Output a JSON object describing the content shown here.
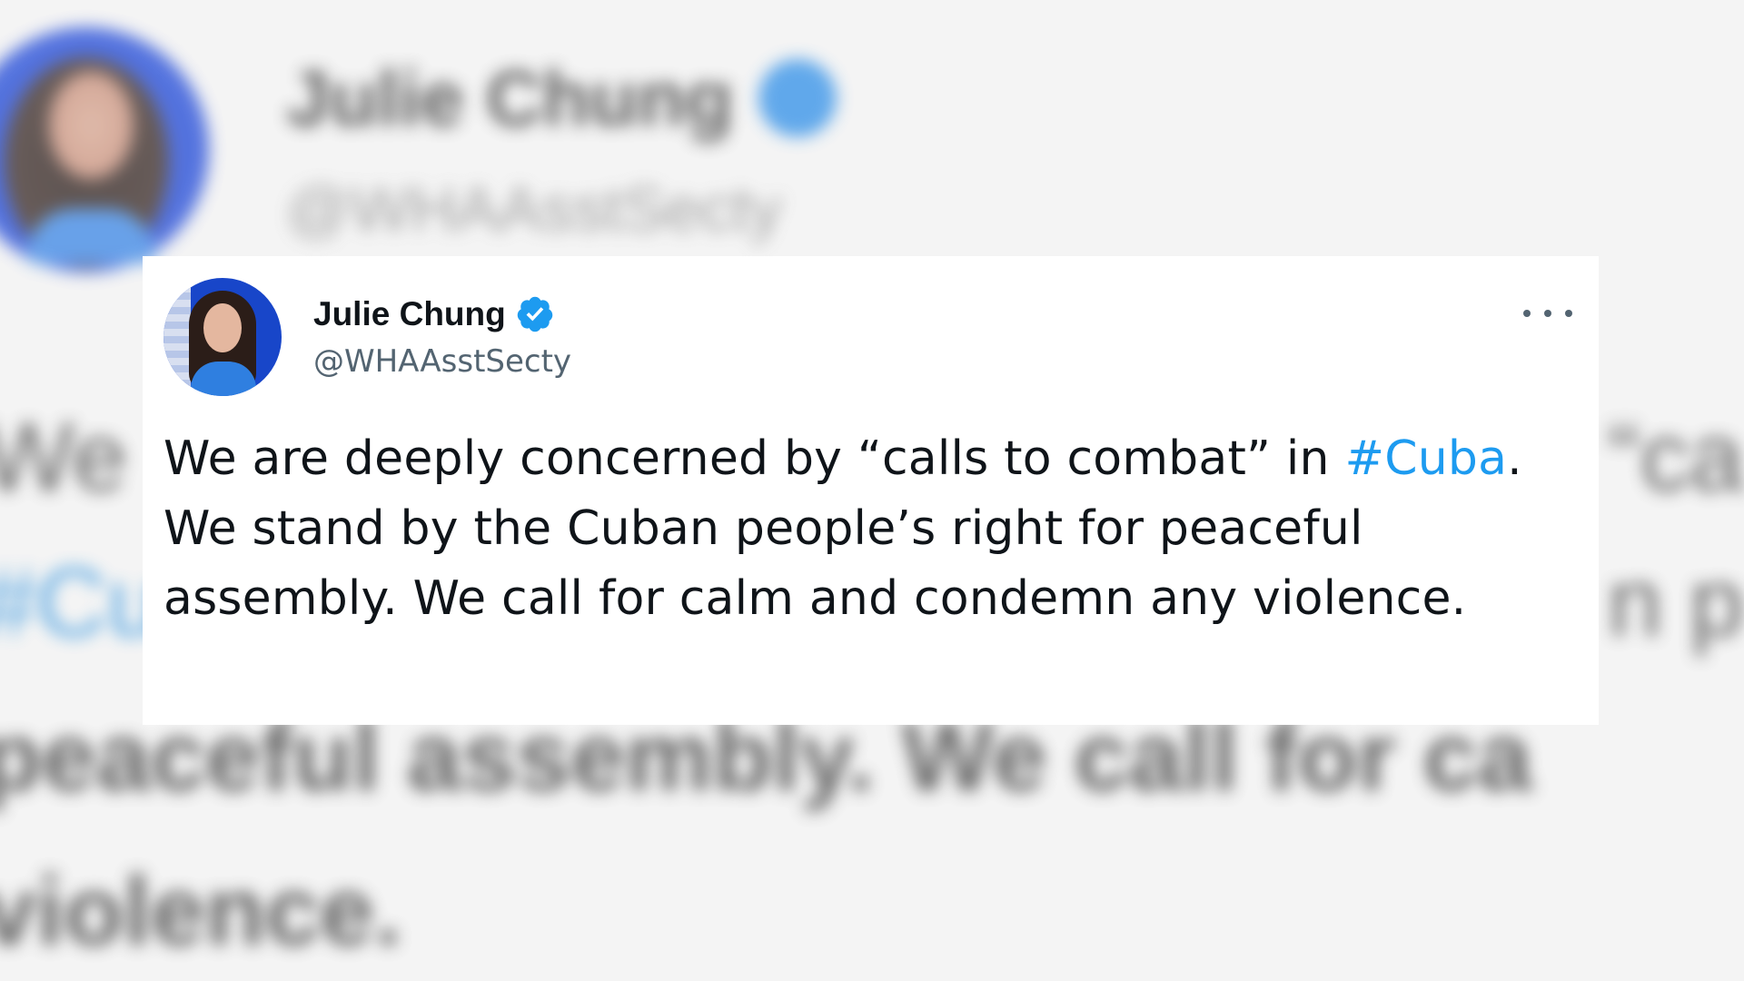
{
  "tweet": {
    "author_name": "Julie Chung",
    "handle": "@WHAAsstSecty",
    "verified_icon": "verified-badge-icon",
    "more_icon": "more-options-icon",
    "text_before_hashtag": "We are deeply concerned by “calls to combat” in ",
    "hashtag": "#Cuba",
    "text_after_hashtag": ". We stand by the Cuban people’s right for peaceful assembly. We call for calm and condemn any violence."
  },
  "background": {
    "author_name": "Julie Chung",
    "handle": "@WHAAsstSecty",
    "line1": "We",
    "line2": "#Cu",
    "line3": "peaceful assembly. We call for ca",
    "line4": "violence.",
    "right1": "“ca",
    "right2": "n p"
  },
  "colors": {
    "hashtag": "#1d9bf0",
    "verified": "#1d9bf0",
    "avatar_background": "#1846c9"
  }
}
